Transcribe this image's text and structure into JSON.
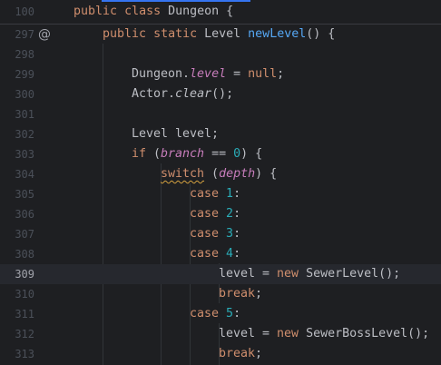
{
  "editor": {
    "sticky": {
      "line_number": "100",
      "tokens": [
        "public",
        "class",
        "Dungeon",
        "{"
      ]
    },
    "lines": [
      {
        "number": "297",
        "marker": "@"
      },
      {
        "number": "298"
      },
      {
        "number": "299"
      },
      {
        "number": "300"
      },
      {
        "number": "301"
      },
      {
        "number": "302"
      },
      {
        "number": "303"
      },
      {
        "number": "304"
      },
      {
        "number": "305"
      },
      {
        "number": "306"
      },
      {
        "number": "307"
      },
      {
        "number": "308"
      },
      {
        "number": "309"
      },
      {
        "number": "310"
      },
      {
        "number": "311"
      },
      {
        "number": "312"
      },
      {
        "number": "313"
      }
    ],
    "current_line": "309",
    "code": {
      "l297": {
        "t1": "public",
        "t2": "static",
        "t3": "Level",
        "t4": "newLevel",
        "t5": "() {"
      },
      "l299": {
        "t1": "Dungeon.",
        "t2": "level",
        "t3": " = ",
        "t4": "null",
        "t5": ";"
      },
      "l300": {
        "t1": "Actor.",
        "t2": "clear",
        "t3": "();"
      },
      "l302": {
        "t1": "Level level;"
      },
      "l303": {
        "t1": "if",
        "t2": " (",
        "t3": "branch",
        "t4": " == ",
        "t5": "0",
        "t6": ") {"
      },
      "l304": {
        "t1": "switch",
        "t2": " (",
        "t3": "depth",
        "t4": ") {"
      },
      "l305": {
        "t1": "case",
        "t2": "1",
        "t3": ":"
      },
      "l306": {
        "t1": "case",
        "t2": "2",
        "t3": ":"
      },
      "l307": {
        "t1": "case",
        "t2": "3",
        "t3": ":"
      },
      "l308": {
        "t1": "case",
        "t2": "4",
        "t3": ":"
      },
      "l309": {
        "t1": "level = ",
        "t2": "new",
        "t3": " SewerLevel();"
      },
      "l310": {
        "t1": "break",
        "t2": ";"
      },
      "l311": {
        "t1": "case",
        "t2": "5",
        "t3": ":"
      },
      "l312": {
        "t1": "level = ",
        "t2": "new",
        "t3": " SewerBossLevel();"
      },
      "l313": {
        "t1": "break",
        "t2": ";"
      }
    }
  },
  "colors": {
    "background": "#1e1f22",
    "keyword": "#cf8e6d",
    "method": "#56a8f5",
    "field": "#c77dbb",
    "number": "#2aacb8",
    "text": "#bcbec4",
    "line_number": "#4b5059",
    "current_line": "#26282e",
    "accent": "#3574f0"
  }
}
